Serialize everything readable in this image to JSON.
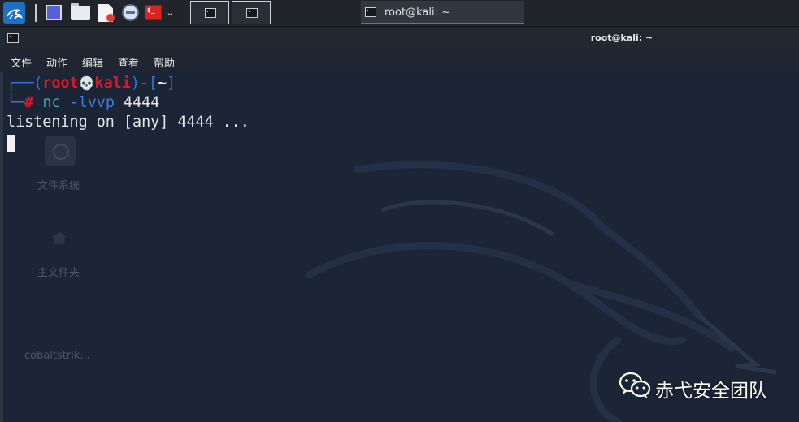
{
  "taskbar": {
    "launchers": [
      "kali-menu-icon",
      "show-desktop-icon",
      "file-manager-icon",
      "text-editor-icon",
      "web-browser-icon",
      "terminal-icon"
    ],
    "active_task_label": "root@kali: ~"
  },
  "window": {
    "title": "root@kali: ~"
  },
  "menubar": {
    "file": "文件",
    "action": "动作",
    "edit": "编辑",
    "view": "查看",
    "help": "帮助"
  },
  "terminal": {
    "prompt": {
      "frame_open": "┌──(",
      "user": "root",
      "skull": "💀",
      "host": "kali",
      "frame_mid": ")-[",
      "dir": "~",
      "frame_close": "]",
      "corner": "└─",
      "hash": "#",
      "command": "nc",
      "args": "-lvvp",
      "port": "4444"
    },
    "output": "listening on [any] 4444 ..."
  },
  "desktop_behind": {
    "filesystem": "文件系统",
    "home": "主文件夹",
    "cobaltstrike": "cobaltstrik..."
  },
  "watermark": {
    "text": "赤弋安全团队"
  },
  "colors": {
    "prompt_frame": "#3b6fd8",
    "prompt_user_host": "#e0162b",
    "command": "#3ea0b3",
    "terminal_bg": "#1c2535",
    "accent": "#2f80d6"
  }
}
